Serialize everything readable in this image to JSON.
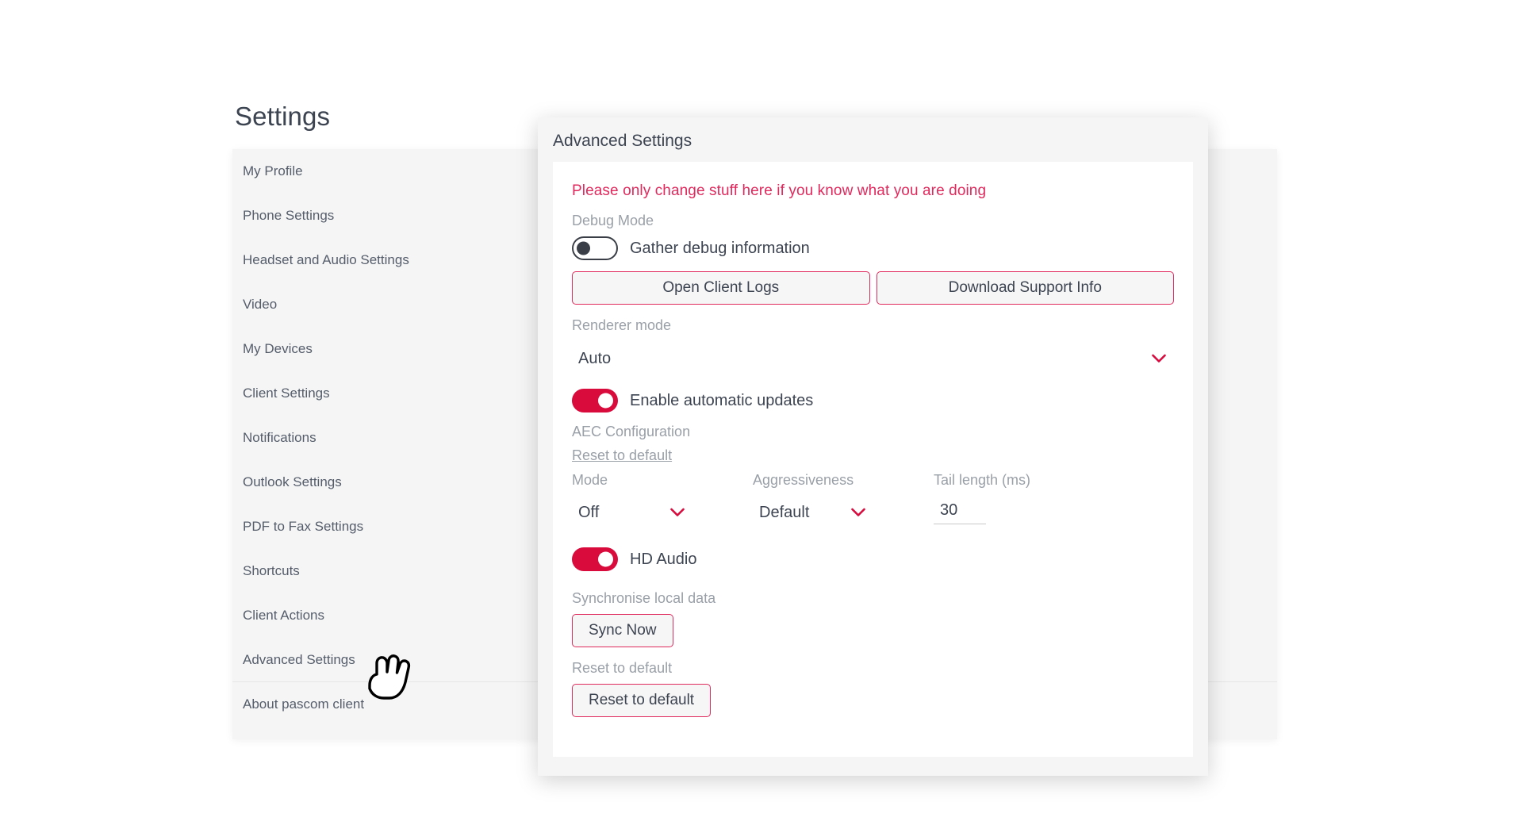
{
  "page": {
    "title": "Settings"
  },
  "sidebar": {
    "items": [
      {
        "label": "My Profile"
      },
      {
        "label": "Phone Settings"
      },
      {
        "label": "Headset and Audio Settings"
      },
      {
        "label": "Video"
      },
      {
        "label": "My Devices"
      },
      {
        "label": "Client Settings"
      },
      {
        "label": "Notifications"
      },
      {
        "label": "Outlook Settings"
      },
      {
        "label": "PDF to Fax Settings"
      },
      {
        "label": "Shortcuts"
      },
      {
        "label": "Client Actions"
      },
      {
        "label": "Advanced Settings"
      },
      {
        "label": "About pascom client"
      }
    ]
  },
  "dialog": {
    "title": "Advanced Settings",
    "warning": "Please only change stuff here if you know what you are doing",
    "debug": {
      "section_label": "Debug Mode",
      "gather_label": "Gather debug information",
      "gather_state": "off",
      "open_logs_label": "Open Client Logs",
      "download_support_label": "Download Support Info"
    },
    "renderer": {
      "section_label": "Renderer mode",
      "selected": "Auto",
      "options": [
        "Auto"
      ]
    },
    "updates": {
      "label": "Enable automatic updates",
      "state": "on"
    },
    "aec": {
      "section_label": "AEC Configuration",
      "reset_link": "Reset to default",
      "mode": {
        "header": "Mode",
        "selected": "Off",
        "options": [
          "Off"
        ]
      },
      "aggressiveness": {
        "header": "Aggressiveness",
        "selected": "Default",
        "options": [
          "Default"
        ]
      },
      "tail_length": {
        "header": "Tail length (ms)",
        "value": "30"
      }
    },
    "hd_audio": {
      "label": "HD Audio",
      "state": "on"
    },
    "sync": {
      "section_label": "Synchronise local data",
      "button_label": "Sync Now"
    },
    "reset": {
      "section_label": "Reset to default",
      "button_label": "Reset to default"
    }
  },
  "colors": {
    "accent": "#d90a3c",
    "accent_border": "#e0295c",
    "warning_text": "#e0295c",
    "text_primary": "#3d4451",
    "text_muted": "#9aa0a8",
    "panel_bg": "#f5f5f5"
  }
}
